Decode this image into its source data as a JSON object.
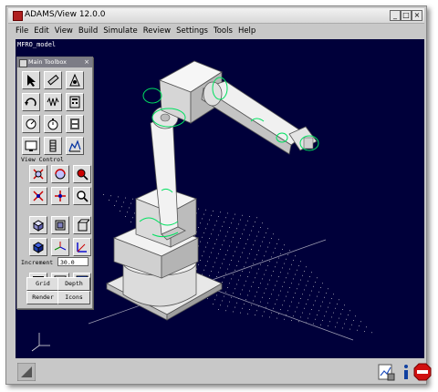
{
  "window": {
    "title": "ADAMS/View 12.0.0",
    "minimize": "_",
    "maximize": "□",
    "close": "×"
  },
  "menu": [
    "File",
    "Edit",
    "View",
    "Build",
    "Simulate",
    "Review",
    "Settings",
    "Tools",
    "Help"
  ],
  "viewport": {
    "model_name": "MFRO_model",
    "background": "#00003a"
  },
  "toolbox": {
    "title": "Main Toolbox",
    "close": "×",
    "section_label": "View Control",
    "increment_label": "Increment",
    "increment_value": "30.0",
    "buttons": {
      "grid": "Grid",
      "depth": "Depth",
      "render": "Render",
      "icons": "Icons"
    }
  },
  "status_icons": [
    "triad-icon",
    "plot-icon",
    "info-icon",
    "stop-icon"
  ],
  "colors": {
    "accent_green": "#00e060",
    "stop_red": "#d01010"
  }
}
